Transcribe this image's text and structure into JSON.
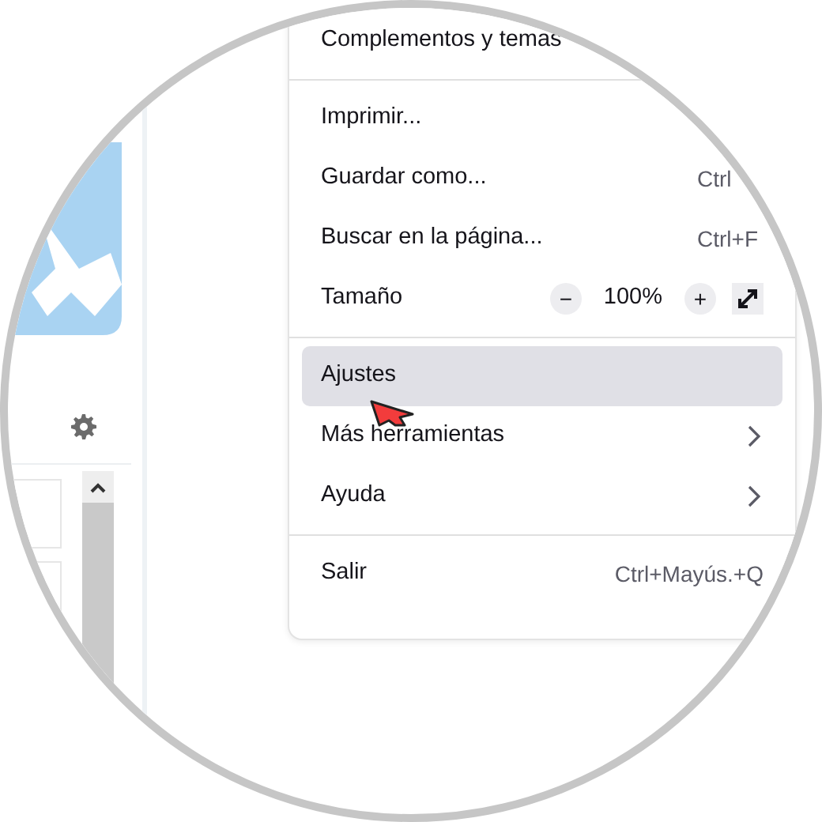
{
  "menu": {
    "items": [
      {
        "kind": "item",
        "label": "Complementos y temas",
        "selected": false
      },
      {
        "kind": "separator"
      },
      {
        "kind": "item",
        "label": "Imprimir...",
        "selected": false
      },
      {
        "kind": "item",
        "label": "Guardar como...",
        "shortcut": "Ctrl",
        "selected": false
      },
      {
        "kind": "item",
        "label": "Buscar en la página...",
        "shortcut": "Ctrl+F",
        "selected": false
      },
      {
        "kind": "zoom",
        "label": "Tamaño",
        "minus": "−",
        "value": "100%",
        "plus": "+"
      },
      {
        "kind": "separator"
      },
      {
        "kind": "item",
        "label": "Ajustes",
        "selected": true
      },
      {
        "kind": "item",
        "label": "Más herramientas",
        "submenu": true,
        "selected": false
      },
      {
        "kind": "item",
        "label": "Ayuda",
        "submenu": true,
        "selected": false
      },
      {
        "kind": "separator"
      },
      {
        "kind": "item",
        "label": "Salir",
        "shortcut": "Ctrl+Mayús.+Q",
        "selected": false
      }
    ]
  }
}
